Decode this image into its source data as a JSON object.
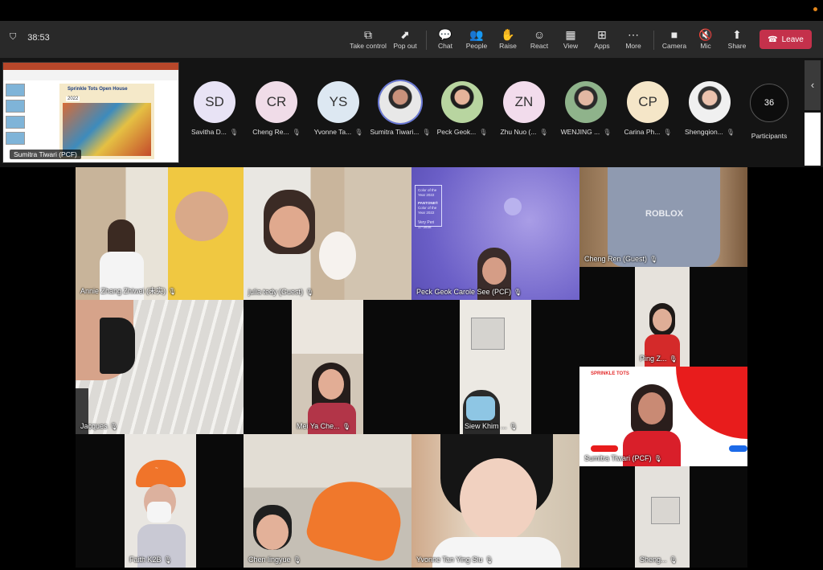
{
  "meeting": {
    "timer": "38:53",
    "toolbar": [
      {
        "label": "Take control",
        "icon": "take-control-icon",
        "glyph": "⧉"
      },
      {
        "label": "Pop out",
        "icon": "pop-out-icon",
        "glyph": "⬈"
      },
      {
        "label": "Chat",
        "icon": "chat-icon",
        "glyph": "💬"
      },
      {
        "label": "People",
        "icon": "people-icon",
        "glyph": "👥"
      },
      {
        "label": "Raise",
        "icon": "raise-hand-icon",
        "glyph": "✋"
      },
      {
        "label": "React",
        "icon": "react-icon",
        "glyph": "☺"
      },
      {
        "label": "View",
        "icon": "view-icon",
        "glyph": "▦"
      },
      {
        "label": "Apps",
        "icon": "apps-icon",
        "glyph": "⊞"
      },
      {
        "label": "More",
        "icon": "more-icon",
        "glyph": "⋯"
      },
      {
        "label": "Camera",
        "icon": "camera-off-icon",
        "glyph": "■"
      },
      {
        "label": "Mic",
        "icon": "mic-off-icon",
        "glyph": "🔇"
      },
      {
        "label": "Share",
        "icon": "share-icon",
        "glyph": "⬆"
      }
    ],
    "leave_label": "Leave",
    "leave_color": "#c4314b"
  },
  "share": {
    "presenter": "Sumitra Tiwari (PCF)",
    "slide_title": "Sprinkle Tots Open House",
    "slide_year": "2022"
  },
  "participants": [
    {
      "initials": "SD",
      "name": "Savitha D...",
      "color": "#e8e3f5"
    },
    {
      "initials": "CR",
      "name": "Cheng Re...",
      "color": "#f0dce8"
    },
    {
      "initials": "YS",
      "name": "Yvonne Ta...",
      "color": "#dde8f2"
    },
    {
      "initials": "",
      "name": "Sumitra Tiwari...",
      "color": "#d9d9d9"
    },
    {
      "initials": "",
      "name": "Peck Geok...",
      "color": "#d9d9d9"
    },
    {
      "initials": "ZN",
      "name": "Zhu Nuo (...",
      "color": "#f2dcec"
    },
    {
      "initials": "",
      "name": "WENJING ...",
      "color": "#d9d9d9"
    },
    {
      "initials": "CP",
      "name": "Carina Ph...",
      "color": "#f5e6c8"
    },
    {
      "initials": "",
      "name": "Shengqion...",
      "color": "#d9d9d9"
    }
  ],
  "participant_count": "36",
  "participant_count_label": "Participants",
  "tiles": [
    {
      "name": "Annie  Zhang Zhiwei (末实)"
    },
    {
      "name": "julia tedy (Guest)"
    },
    {
      "name": "Peck Geok Carole See (PCF)"
    },
    {
      "name": "Cheng Ren (Guest)"
    },
    {
      "name": "Ping Z..."
    },
    {
      "name": "Jacques"
    },
    {
      "name": "Mei Ya Che..."
    },
    {
      "name": "Siew Khim ..."
    },
    {
      "name": "Sumitra Tiwari (PCF)"
    },
    {
      "name": "Faith K2B"
    },
    {
      "name": "Chen lingyue"
    },
    {
      "name": "Yvonne Tan Ying Siu"
    },
    {
      "name": "Sheng..."
    }
  ],
  "pantone": {
    "l1": "Color of the Year 2022",
    "l2": "PANTONE®",
    "l3": "Color of the Year 2022",
    "l4": "Very Peri",
    "l5": "17-3938"
  },
  "sprinkle_logo": "SPRINKLE TOTS",
  "tshirt_text": "ROBLOX"
}
